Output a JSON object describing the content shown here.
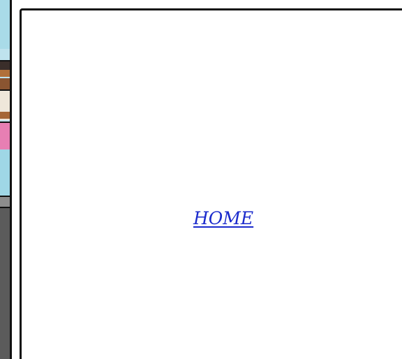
{
  "main_panel": {
    "link_label": "HOME"
  },
  "colors": {
    "link": "#1a2acc",
    "panel_border": "#111111",
    "background": "#ffffff"
  }
}
